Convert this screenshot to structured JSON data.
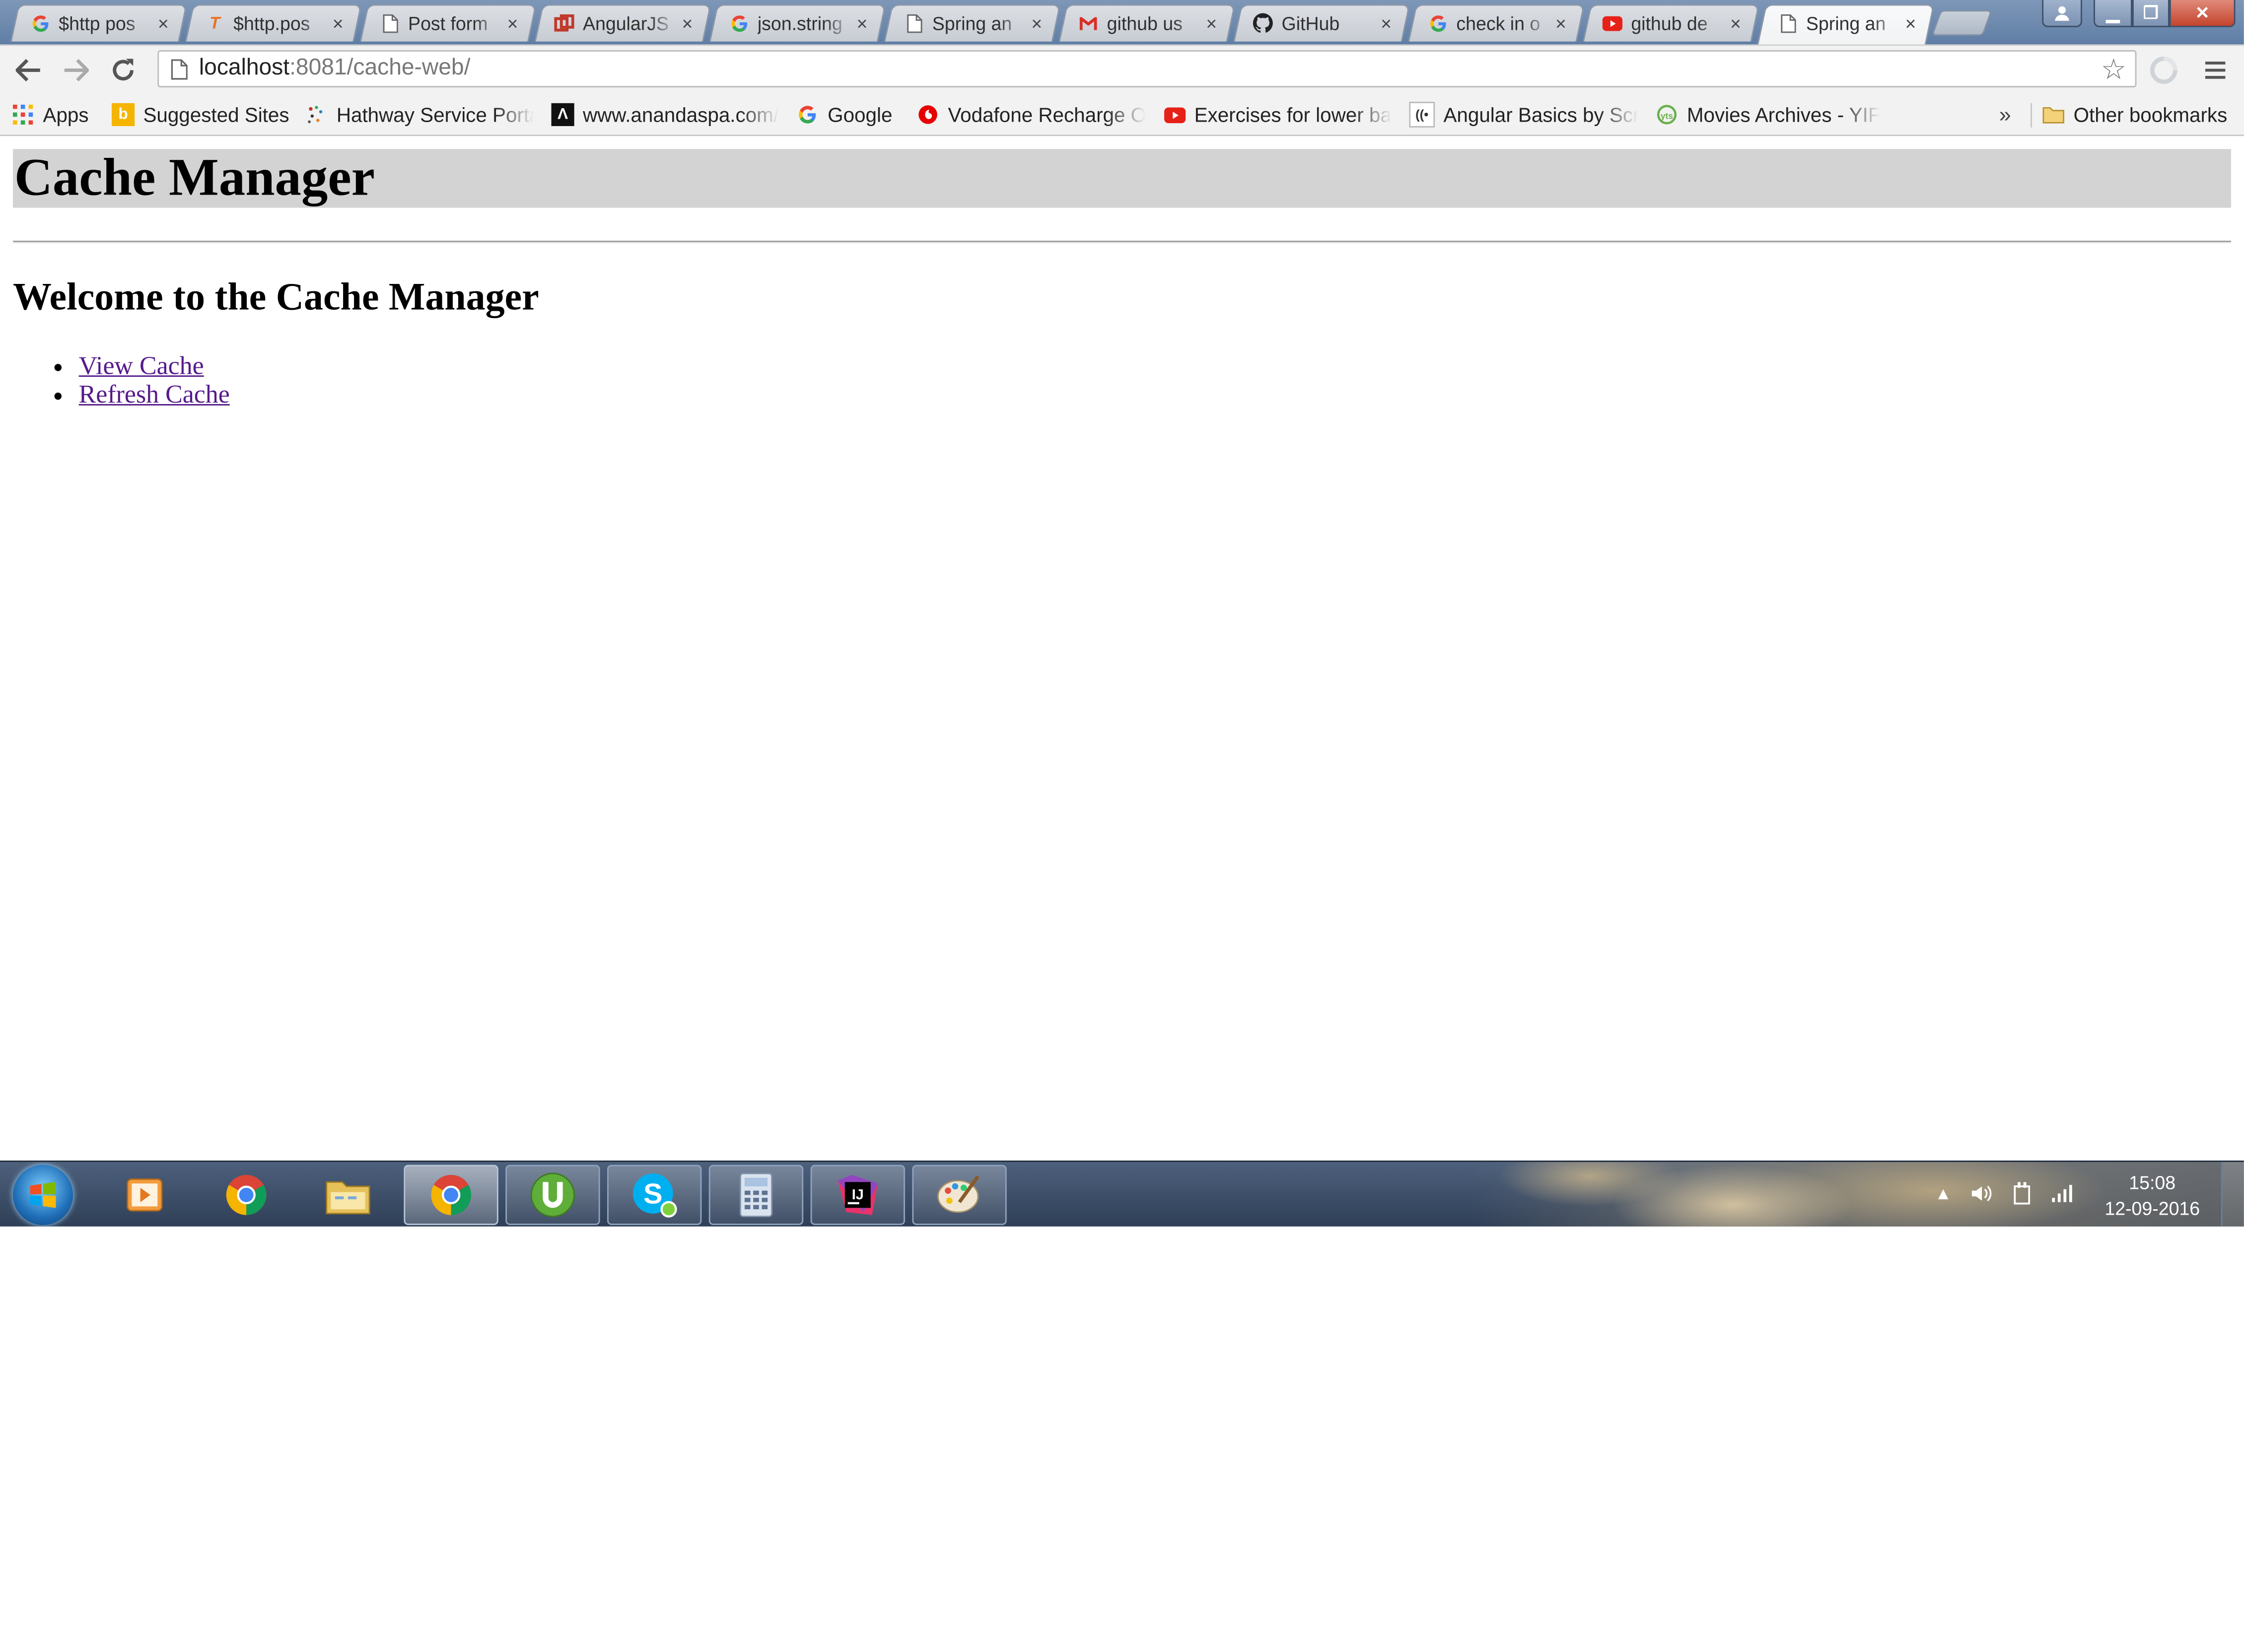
{
  "browser": {
    "tabs": [
      {
        "title": "$http pos",
        "icon": "google-icon"
      },
      {
        "title": "$http.pos",
        "icon": "t-logo-icon"
      },
      {
        "title": "Post form",
        "icon": "page-icon"
      },
      {
        "title": "AngularJS",
        "icon": "angularjs-icon"
      },
      {
        "title": "json.string",
        "icon": "google-icon"
      },
      {
        "title": "Spring an",
        "icon": "page-icon"
      },
      {
        "title": "github us",
        "icon": "gmail-icon"
      },
      {
        "title": "GitHub",
        "icon": "github-icon"
      },
      {
        "title": "check in o",
        "icon": "google-icon"
      },
      {
        "title": "github de",
        "icon": "youtube-icon"
      },
      {
        "title": "Spring an",
        "icon": "page-icon",
        "active": true
      }
    ],
    "tab_close_glyph": "×",
    "window_controls": {
      "minimize": "▁",
      "maximize": "❐",
      "close": "✕"
    },
    "address": {
      "host": "localhost",
      "rest": ":8081/cache-web/"
    },
    "bookmarks": [
      {
        "label": "Apps",
        "icon": "apps-grid-icon"
      },
      {
        "label": "Suggested Sites",
        "icon": "bing-icon"
      },
      {
        "label": "Hathway Service Porta",
        "icon": "hathway-icon"
      },
      {
        "label": "www.anandaspa.com/",
        "icon": "anandaspa-icon"
      },
      {
        "label": "Google",
        "icon": "google-icon"
      },
      {
        "label": "Vodafone Recharge O",
        "icon": "vodafone-icon"
      },
      {
        "label": "Exercises for lower ba",
        "icon": "youtube-icon"
      },
      {
        "label": "Angular Basics by Scri",
        "icon": "scrimba-icon"
      },
      {
        "label": "Movies Archives - YIF",
        "icon": "yify-icon"
      }
    ],
    "bookmarks_overflow": "»",
    "other_bookmarks": "Other bookmarks"
  },
  "page": {
    "title": "Cache Manager",
    "welcome": "Welcome to the Cache Manager",
    "links": [
      {
        "label": "View Cache"
      },
      {
        "label": "Refresh Cache"
      }
    ]
  },
  "taskbar": {
    "apps": [
      {
        "name": "media-player-icon"
      },
      {
        "name": "chrome-icon"
      },
      {
        "name": "file-explorer-icon"
      },
      {
        "name": "chrome-icon",
        "active": true
      },
      {
        "name": "utorrent-icon",
        "running": true
      },
      {
        "name": "skype-icon",
        "running": true
      },
      {
        "name": "calculator-icon",
        "running": true
      },
      {
        "name": "intellij-icon",
        "running": true
      },
      {
        "name": "paint-icon",
        "running": true
      }
    ],
    "clock_time": "15:08",
    "clock_date": "12-09-2016",
    "colors": {
      "taskbar": "#3a4b66",
      "link_visited": "#551a8b",
      "header_bg": "#d3d3d3"
    }
  }
}
